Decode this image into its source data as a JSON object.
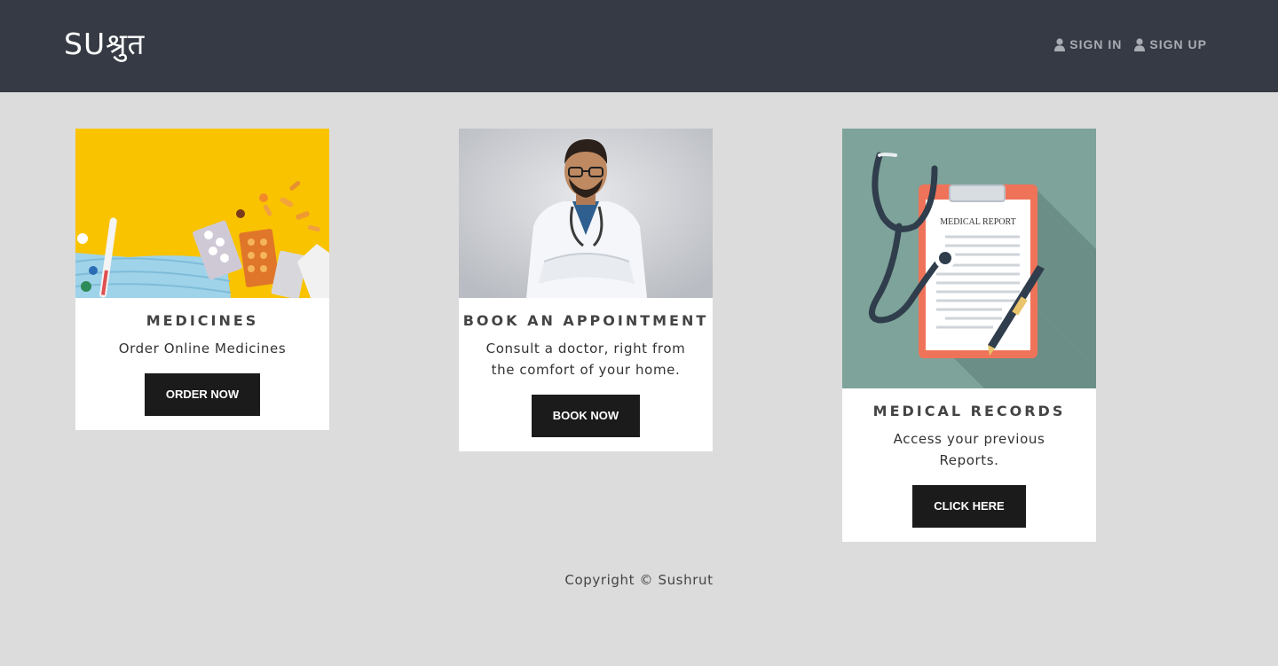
{
  "nav": {
    "brand": "SUश्रुत",
    "links": [
      {
        "label": "SIGN IN",
        "icon": "user-icon"
      },
      {
        "label": "SIGN UP",
        "icon": "user-icon"
      }
    ]
  },
  "cards": [
    {
      "image": "medicines-image",
      "title": "MEDICINES",
      "text": "Order Online Medicines",
      "button": "ORDER NOW"
    },
    {
      "image": "doctor-image",
      "title": "BOOK AN APPOINTMENT",
      "text": "Consult a doctor, right from the comfort of your home.",
      "button": "BOOK NOW"
    },
    {
      "image": "medical-report-image",
      "title": "MEDICAL RECORDS",
      "text": "Access your previous Reports.",
      "button": "CLICK HERE",
      "image_text": "MEDICAL REPORT"
    }
  ],
  "footer": "Copyright © Sushrut",
  "colors": {
    "navbar": "#353a44",
    "background": "#dcdcdc",
    "button": "#1b1b1b"
  }
}
